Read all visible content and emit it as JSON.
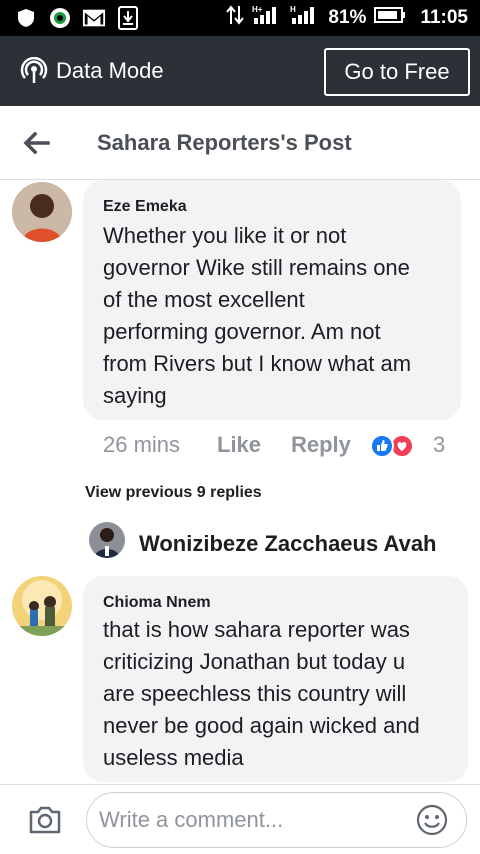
{
  "status_bar": {
    "battery": "81%",
    "time": "11:05",
    "icons": [
      "shield-icon",
      "location-icon",
      "gmail-icon",
      "download-icon",
      "data-transfer-icon",
      "signal-icon",
      "signal-icon",
      "battery-icon"
    ]
  },
  "data_mode": {
    "label": "Data Mode",
    "button": "Go to Free",
    "icon": "broadcast-icon"
  },
  "header": {
    "title": "Sahara Reporters's Post",
    "back_icon": "back-arrow-icon"
  },
  "comments": [
    {
      "author": "Eze Emeka",
      "lines": [
        "Whether you like it or not",
        "governor Wike still remains one",
        "of the most excellent",
        "performing governor. Am not",
        "from Rivers but I know what am",
        "saying"
      ],
      "time": "26 mins",
      "like": "Like",
      "reply": "Reply",
      "reaction_count": "3"
    },
    {
      "author": "Chioma Nnem",
      "lines": [
        "that is how sahara reporter was",
        "criticizing Jonathan but today u",
        "are speechless this country will",
        "never be good again wicked and",
        "useless media"
      ]
    }
  ],
  "view_previous": "View previous 9 replies",
  "reply_preview": {
    "name": "Wonizibeze Zacchaeus Avah"
  },
  "composer": {
    "placeholder": "Write a comment...",
    "camera_icon": "camera-icon",
    "emoji_icon": "smiley-icon"
  },
  "colors": {
    "status_bg": "#000000",
    "data_bar_bg": "#2c3138",
    "bubble_bg": "#f2f3f5",
    "meta_text": "#90949c",
    "like_blue": "#1877f2",
    "love_red": "#f33e58"
  }
}
